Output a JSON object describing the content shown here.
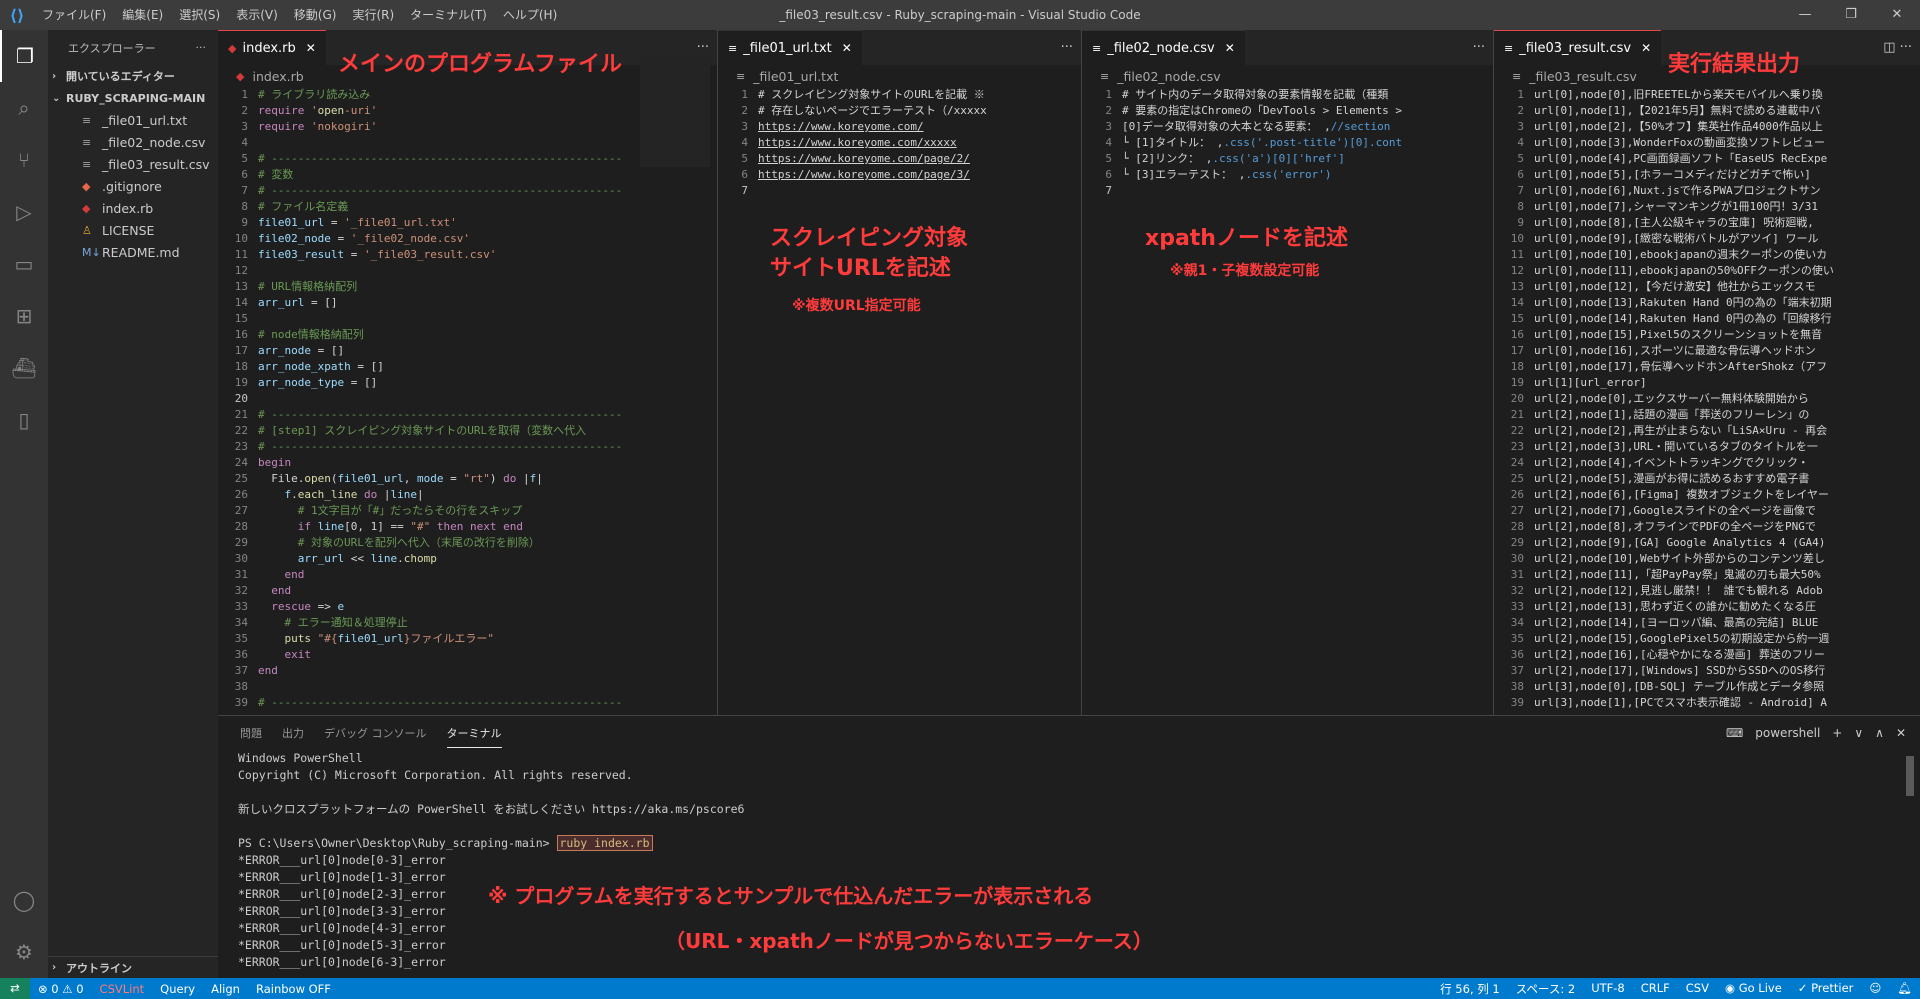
{
  "app": {
    "window_title": "_file03_result.csv - Ruby_scraping-main - Visual Studio Code",
    "menu": [
      "ファイル(F)",
      "編集(E)",
      "選択(S)",
      "表示(V)",
      "移動(G)",
      "実行(R)",
      "ターミナル(T)",
      "ヘルプ(H)"
    ],
    "window_controls": [
      "—",
      "❐",
      "✕"
    ]
  },
  "sidebar": {
    "title": "エクスプローラー",
    "open_editors": "開いているエディター",
    "root": "RUBY_SCRAPING-MAIN",
    "files": [
      {
        "name": "_file01_url.txt",
        "icon": "text-file-icon"
      },
      {
        "name": "_file02_node.csv",
        "icon": "text-file-icon"
      },
      {
        "name": "_file03_result.csv",
        "icon": "text-file-icon"
      },
      {
        "name": ".gitignore",
        "icon": "git-icon"
      },
      {
        "name": "index.rb",
        "icon": "ruby-icon"
      },
      {
        "name": "LICENSE",
        "icon": "license-icon"
      },
      {
        "name": "README.md",
        "icon": "markdown-icon"
      }
    ],
    "outline": "アウトライン"
  },
  "editor1": {
    "tab": "index.rb",
    "crumb": "index.rb",
    "lines": [
      "# ライブラリ読み込み",
      "require 'open-uri'",
      "require 'nokogiri'",
      "",
      "# -----------------------------------------------------",
      "# 変数",
      "# -----------------------------------------------------",
      "# ファイル名定義",
      "file01_url = '_file01_url.txt'",
      "file02_node = '_file02_node.csv'",
      "file03_result = '_file03_result.csv'",
      "",
      "# URL情報格納配列",
      "arr_url = []",
      "",
      "# node情報格納配列",
      "arr_node = []",
      "arr_node_xpath = []",
      "arr_node_type = []",
      "",
      "# -----------------------------------------------------",
      "# [step1] スクレイピング対象サイトのURLを取得（変数へ代入",
      "# -----------------------------------------------------",
      "begin",
      "  File.open(file01_url, mode = \"rt\") do |f|",
      "    f.each_line do |line|",
      "      # 1文字目が「#」だったらその行をスキップ",
      "      if line[0, 1] == \"#\" then next end",
      "      # 対象のURLを配列へ代入（末尾の改行を削除）",
      "      arr_url << line.chomp",
      "    end",
      "  end",
      "  rescue => e",
      "    # エラー通知＆処理停止",
      "    puts \"#{file01_url}ファイルエラー\"",
      "    exit",
      "end",
      "",
      "# -----------------------------------------------------"
    ]
  },
  "editor2": {
    "tab": "_file01_url.txt",
    "crumb": "_file01_url.txt",
    "lines": [
      "# スクレイピング対象サイトのURLを記載 ※",
      "# 存在しないページでエラーテスト（/xxxxx",
      "https://www.koreyome.com/",
      "https://www.koreyome.com/xxxxx",
      "https://www.koreyome.com/page/2/",
      "https://www.koreyome.com/page/3/",
      ""
    ]
  },
  "editor3": {
    "tab": "_file02_node.csv",
    "crumb": "_file02_node.csv",
    "lines": [
      "# サイト内のデータ取得対象の要素情報を記載（種類",
      "# 要素の指定はChromeの「DevTools > Elements >",
      "[0]データ取得対象の大本となる要素： ,//section",
      "└ [1]タイトル： ,.css('.post-title')[0].cont",
      "└ [2]リンク： ,.css('a')[0]['href']",
      "└ [3]エラーテスト： ,.css('error')",
      ""
    ]
  },
  "editor4": {
    "tab": "_file03_result.csv",
    "crumb": "_file03_result.csv",
    "lines": [
      "url[0],node[0],旧FREETELから楽天モバイルへ乗り換",
      "url[0],node[1],【2021年5月】無料で読める連載中バ",
      "url[0],node[2],【50%オフ】集英社作品4000作品以上",
      "url[0],node[3],WonderFoxの動画変換ソフトレビュー",
      "url[0],node[4],PC画面録画ソフト「EaseUS RecExpe",
      "url[0],node[5],[ホラーコメディだけどガチで怖い]",
      "url[0],node[6],Nuxt.jsで作るPWAプロジェクトサン",
      "url[0],node[7],シャーマンキングが1冊100円！3/31",
      "url[0],node[8],[主人公級キャラの宝庫] 呪術廻戦,",
      "url[0],node[9],[緻密な戦術バトルがアツイ] ワール",
      "url[0],node[10],ebookjapanの週末クーポンの使いカ",
      "url[0],node[11],ebookjapanの50%OFFクーポンの使い",
      "url[0],node[12],【今だけ激安】他社からエックスモ",
      "url[0],node[13],Rakuten Hand 0円の為の「端末初期",
      "url[0],node[14],Rakuten Hand 0円の為の「回線移行",
      "url[0],node[15],Pixel5のスクリーンショットを無音",
      "url[0],node[16],スポーツに最適な骨伝導ヘッドホン",
      "url[0],node[17],骨伝導ヘッドホンAfterShokz（アフ",
      "url[1][url_error]",
      "url[2],node[0],エックスサーバー無料体験開始から",
      "url[2],node[1],話題の漫画「葬送のフリーレン」の",
      "url[2],node[2],再生が止まらない「LiSA×Uru - 再会",
      "url[2],node[3],URL・開いているタブのタイトルを一",
      "url[2],node[4],イベントトラッキングでクリック・",
      "url[2],node[5],漫画がお得に読めるおすすめ電子書",
      "url[2],node[6],[Figma] 複数オブジェクトをレイヤー",
      "url[2],node[7],Googleスライドの全ページを画像で",
      "url[2],node[8],オフラインでPDFの全ページをPNGで",
      "url[2],node[9],[GA] Google Analytics 4 (GA4)",
      "url[2],node[10],Webサイト外部からのコンテンツ差し",
      "url[2],node[11],「超PayPay祭」鬼滅の刃も最大50%",
      "url[2],node[12],見逃し厳禁！！ 誰でも観れる Adob",
      "url[2],node[13],思わず近くの誰かに勧めたくなる圧",
      "url[2],node[14],[ヨーロッパ編、最高の完結] BLUE",
      "url[2],node[15],GooglePixel5の初期設定から約一週",
      "url[2],node[16],[心穏やかになる漫画] 葬送のフリー",
      "url[2],node[17],[Windows] SSDからSSDへのOS移行",
      "url[3],node[0],[DB-SQL] テーブル作成とデータ参照",
      "url[3],node[1],[PCでスマホ表示確認 - Android] A"
    ]
  },
  "panel": {
    "tabs": [
      "問題",
      "出力",
      "デバッグ コンソール",
      "ターミナル"
    ],
    "shell": "powershell",
    "actions": [
      "+",
      "∨",
      "∧",
      "✕"
    ],
    "terminal_lines": [
      "Windows PowerShell",
      "Copyright (C) Microsoft Corporation. All rights reserved.",
      "",
      "新しいクロスプラットフォームの PowerShell をお試しください https://aka.ms/pscore6",
      ""
    ],
    "prompt": "PS C:\\Users\\Owner\\Desktop\\Ruby_scraping-main> ",
    "command": "ruby index.rb",
    "errors": [
      "*ERROR___url[0]node[0-3]_error",
      "*ERROR___url[0]node[1-3]_error",
      "*ERROR___url[0]node[2-3]_error",
      "*ERROR___url[0]node[3-3]_error",
      "*ERROR___url[0]node[4-3]_error",
      "*ERROR___url[0]node[5-3]_error",
      "*ERROR___url[0]node[6-3]_error"
    ]
  },
  "status": {
    "errors": "⊗ 0 ⚠ 0",
    "csvlint": "CSVLint",
    "query": "Query",
    "align": "Align",
    "rainbow": "Rainbow OFF",
    "position": "行 56, 列 1",
    "spaces": "スペース: 2",
    "encoding": "UTF-8",
    "eol": "CRLF",
    "lang": "CSV",
    "golive": "Go Live",
    "prettier": "Prettier"
  },
  "annotations": {
    "main_program": "メインのプログラムファイル",
    "result_output": "実行結果出力",
    "scraping_target_1": "スクレイピング対象",
    "scraping_target_2": "サイトURLを記述",
    "multi_url": "※複数URL指定可能",
    "xpath_node": "xpathノードを記述",
    "parent_child": "※親1・子複数設定可能",
    "run_note": "※ プログラムを実行するとサンプルで仕込んだエラーが表示される",
    "error_case": "（URL・xpathノードが見つからないエラーケース）"
  },
  "colors": {
    "accent": "#007acc",
    "annotation": "#ff3b3b",
    "active_tab_border": "#e44747"
  }
}
